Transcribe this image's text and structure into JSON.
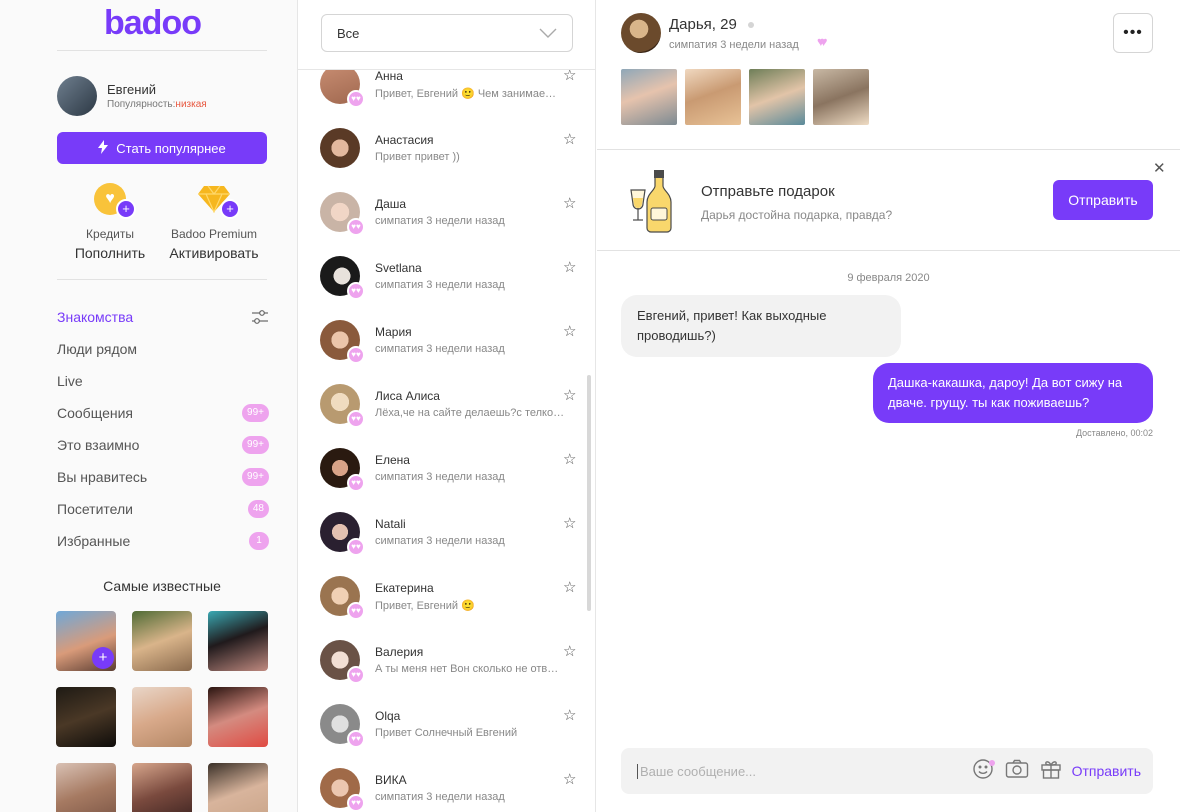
{
  "brand": {
    "logo": "badoo",
    "accent": "#783bf9",
    "badge_color": "#eea3ee",
    "gift_button_color": "#783bf9"
  },
  "me": {
    "name": "Евгений",
    "popularity_label": "Популярность:",
    "popularity_value": "низкая"
  },
  "boost_button": "Стать популярнее",
  "services": [
    {
      "title": "Кредиты",
      "action": "Пополнить",
      "icon": "coin-icon"
    },
    {
      "title": "Badoo Premium",
      "action": "Активировать",
      "icon": "diamond-icon"
    }
  ],
  "nav": [
    {
      "label": "Знакомства",
      "badge": ""
    },
    {
      "label": "Люди рядом",
      "badge": ""
    },
    {
      "label": "Live",
      "badge": ""
    },
    {
      "label": "Сообщения",
      "badge": "99+"
    },
    {
      "label": "Это взаимно",
      "badge": "99+"
    },
    {
      "label": "Вы нравитесь",
      "badge": "99+"
    },
    {
      "label": "Посетители",
      "badge": "48"
    },
    {
      "label": "Избранные",
      "badge": "1"
    }
  ],
  "famous_title": "Самые известные",
  "filter": {
    "value": "Все"
  },
  "conversations": [
    {
      "name": "Анна",
      "message": "Привет, Евгений 🙂 Чем занимае…"
    },
    {
      "name": "Анастасия",
      "message": "Привет привет ))"
    },
    {
      "name": "Даша",
      "message": "симпатия 3 недели назад"
    },
    {
      "name": "Svetlana",
      "message": "симпатия 3 недели назад"
    },
    {
      "name": "Мария",
      "message": "симпатия 3 недели назад"
    },
    {
      "name": "Лиса Алиса",
      "message": "Лёха,че на сайте делаешь?с телко…"
    },
    {
      "name": "Елена",
      "message": "симпатия 3 недели назад"
    },
    {
      "name": "Natali",
      "message": "симпатия 3 недели назад"
    },
    {
      "name": "Екатерина",
      "message": "Привет, Евгений 🙂"
    },
    {
      "name": "Валерия",
      "message": "А ты меня нет Вон сколько не отв…"
    },
    {
      "name": "Olqa",
      "message": "Привет Солнечный Евгений"
    },
    {
      "name": "ВИКА",
      "message": "симпатия 3 недели назад"
    }
  ],
  "chat": {
    "name": "Дарья, 29",
    "subtitle": "симпатия 3 недели назад",
    "gift": {
      "title": "Отправьте подарок",
      "subtitle": "Дарья достойна подарка, правда?",
      "button": "Отправить"
    },
    "date": "9 февраля 2020",
    "messages": [
      {
        "from": "them",
        "text": "Евгений, привет! Как выходные проводишь?)"
      },
      {
        "from": "me",
        "text": "Дашка-какашка, дароу! Да вот сижу на дваче. грущу. ты как поживаешь?"
      }
    ],
    "status": "Доставлено, 00:02",
    "input_placeholder": "Ваше сообщение...",
    "send_label": "Отправить"
  }
}
